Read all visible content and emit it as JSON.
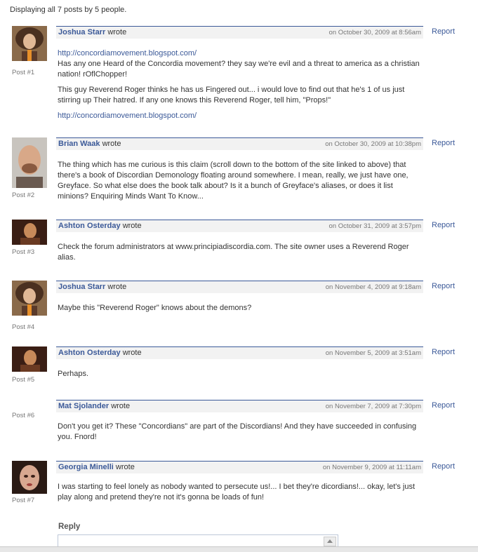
{
  "summary": "Displaying all 7 posts by 5 people.",
  "report_label": "Report",
  "wrote_label": "wrote",
  "posts": [
    {
      "author": "Joshua Starr",
      "date": "on October 30, 2009 at 8:56am",
      "post_number": "Post #1",
      "avatar": "curly-hair-man-avatar",
      "link_top": "http://concordiamovement.blogspot.com/",
      "paragraphs": [
        "Has any one Heard of the Concordia movement? they say we're evil and a threat to america as a christian nation! rOflChopper!",
        "This guy Reverend Roger thinks he has us Fingered out... i would love to find out that he's 1 of us just stirring up Their hatred. If any one knows this Reverend Roger, tell him, \"Props!\""
      ],
      "link_bottom": "http://concordiamovement.blogspot.com/"
    },
    {
      "author": "Brian Waak",
      "date": "on October 30, 2009 at 10:38pm",
      "post_number": "Post #2",
      "avatar": "bald-man-avatar",
      "paragraphs": [
        "The thing which has me curious is this claim (scroll down to the bottom of the site linked to above) that there's a book of Discordian Demonology floating around somewhere. I mean, really, we just have one, Greyface. So what else does the book talk about? Is it a bunch of Greyface's aliases, or does it list minions? Enquiring Minds Want To Know..."
      ]
    },
    {
      "author": "Ashton Osterday",
      "date": "on October 31, 2009 at 3:57pm",
      "post_number": "Post #3",
      "avatar": "dark-portrait-avatar",
      "paragraphs": [
        "Check the forum administrators at www.principiadiscordia.com. The site owner uses a Reverend Roger alias."
      ]
    },
    {
      "author": "Joshua Starr",
      "date": "on November 4, 2009 at 9:18am",
      "post_number": "Post #4",
      "avatar": "curly-hair-man-avatar",
      "paragraphs": [
        "Maybe this \"Reverend Roger\" knows about the demons?"
      ]
    },
    {
      "author": "Ashton Osterday",
      "date": "on November 5, 2009 at 3:51am",
      "post_number": "Post #5",
      "avatar": "dark-portrait-avatar",
      "paragraphs": [
        "Perhaps."
      ]
    },
    {
      "author": "Mat Sjolander",
      "date": "on November 7, 2009 at 7:30pm",
      "post_number": "Post #6",
      "avatar": "none",
      "paragraphs": [
        "Don't you get it? These \"Concordians\" are part of the Discordians! And they have succeeded in confusing you. Fnord!"
      ]
    },
    {
      "author": "Georgia Minelli",
      "date": "on November 9, 2009 at 11:11am",
      "post_number": "Post #7",
      "avatar": "woman-portrait-avatar",
      "paragraphs": [
        "I was starting to feel lonely as nobody wanted to persecute us!... I bet they're dicordians!... okay, let's just play along and pretend they're not it's gonna be loads of fun!"
      ]
    }
  ],
  "reply": {
    "label": "Reply",
    "value": ""
  },
  "colors": {
    "link": "#3b5998",
    "header_bg": "#f2f2f2",
    "text": "#333333",
    "muted": "#777777"
  }
}
